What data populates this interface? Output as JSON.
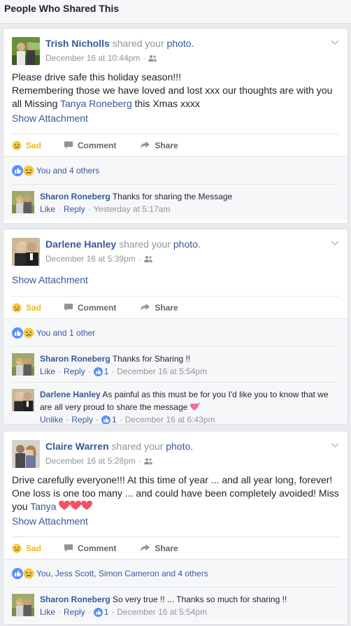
{
  "header": {
    "title": "People Who Shared This"
  },
  "common": {
    "shared_your": "shared your",
    "photo": "photo.",
    "show_attachment": "Show Attachment",
    "sad": "Sad",
    "comment": "Comment",
    "share": "Share",
    "like": "Like",
    "reply": "Reply",
    "unlike": "Unlike",
    "dot": "·"
  },
  "posts": [
    {
      "name": "Trish Nicholls",
      "time": "December 16 at 10:44pm",
      "text_line1": "Please drive safe this holiday season!!!",
      "text_line2a": "Remembering those we have loved and lost xxx our thoughts are with you all Missing ",
      "text_link": "Tanya Roneberg",
      "text_line2b": " this Xmas xxxx",
      "reactions": "You and 4 others",
      "comments": [
        {
          "name": "Sharon Roneberg",
          "text": "Thanks for sharing the Message",
          "time": "Yesterday at 5:17am"
        }
      ]
    },
    {
      "name": "Darlene Hanley",
      "time": "December 16 at 5:39pm",
      "reactions": "You and 1 other",
      "comments": [
        {
          "name": "Sharon Roneberg",
          "text": "Thanks for Sharing !!",
          "likes": "1",
          "time": "December 16 at 5:54pm"
        },
        {
          "name": "Darlene Hanley",
          "text": "As painful as this must be for you I'd like you to know that we are all very proud to share the message",
          "likes": "1",
          "time": "December 16 at 6:43pm"
        }
      ]
    },
    {
      "name": "Claire Warren",
      "time": "December 16 at 5:28pm",
      "text_a": "Drive carefully everyone!!! At this time of year ... and all year long, forever! One loss is one too many ... and could have been completely avoided! Miss you ",
      "text_link": "Tanya",
      "reactions": "You, Jess Scott, Simon Cameron and 4 others",
      "comments": [
        {
          "name": "Sharon Roneberg",
          "text": "So very true !! ... Thanks so much for sharing !!",
          "likes": "1",
          "time": "December 16 at 5:54pm"
        }
      ]
    }
  ]
}
